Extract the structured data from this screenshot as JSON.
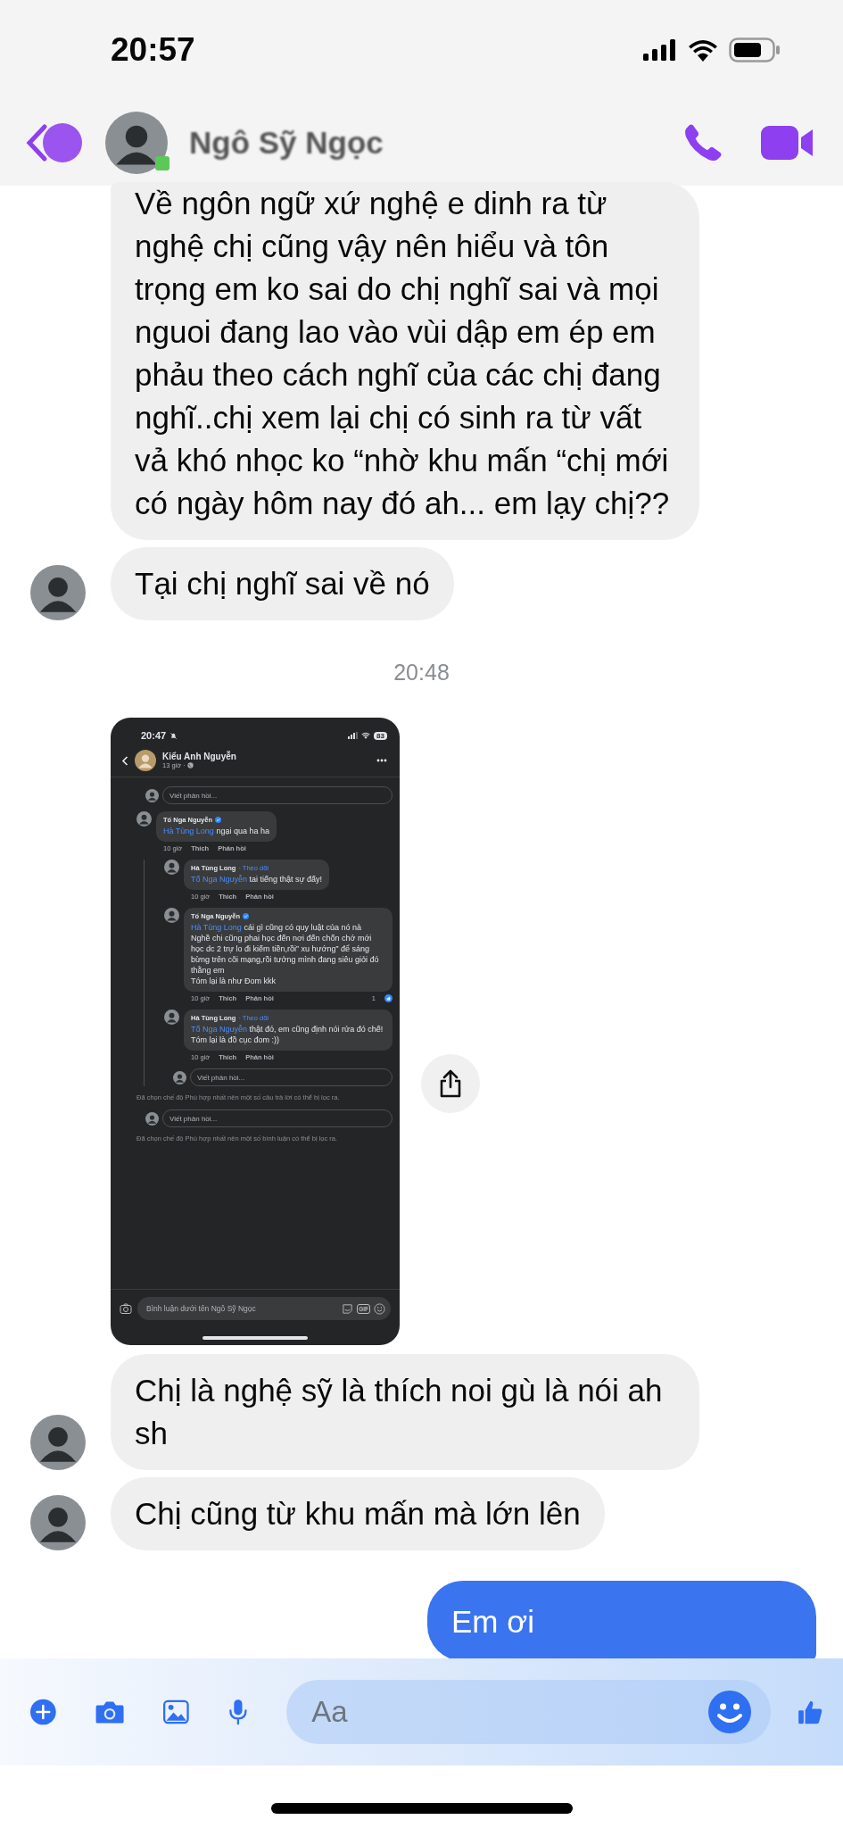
{
  "status_bar": {
    "time": "20:57"
  },
  "header": {
    "name": "Ngô Sỹ Ngọc"
  },
  "messages": [
    {
      "kind": "text",
      "outgoing": false,
      "avatar": false,
      "text": "Về ngôn ngữ xứ nghệ e dinh ra từ nghệ chị cũng vậy nên hiểu và tôn trọng em ko sai do chị nghĩ sai và mọi nguoi đang lao vào vùi dập em ép em phảu theo cách nghĩ của các chị đang nghĩ..chị xem lại chị có sinh ra từ vất vả khó nhọc ko “nhờ khu mấn “chị mới có ngày hôm nay đó ah... em lạy chị??"
    },
    {
      "kind": "text",
      "outgoing": false,
      "avatar": true,
      "text": "Tại chị nghĩ sai về nó"
    },
    {
      "kind": "time",
      "text": "20:48"
    },
    {
      "kind": "screenshot",
      "outgoing": false,
      "avatar": false,
      "shot": {
        "time": "20:47",
        "battery": "83",
        "author": "Kiểu Anh Nguyễn",
        "meta": "13 giờ ·",
        "thread": [
          {
            "kind": "reply_field",
            "placeholder": "Viết phản hồi..."
          },
          {
            "kind": "comment",
            "author": "Tố Nga Nguyễn",
            "verified": true,
            "mention": "Hà Tùng Long",
            "text": "ngại qua ha ha",
            "time": "10 giờ",
            "like": "Thích",
            "reply": "Phản hồi",
            "children": [
              {
                "kind": "comment",
                "author": "Hà Tùng Long",
                "follow": "· Theo dõi",
                "verified": false,
                "mention": "Tố Nga Nguyễn",
                "text": "tai tiếng thật sự đấy!",
                "time": "10 giờ",
                "like": "Thích",
                "reply": "Phản hồi"
              },
              {
                "kind": "comment",
                "author": "Tố Nga Nguyễn",
                "verified": true,
                "mention": "Hà Tùng Long",
                "text": "cái gì cũng có quy luật của nó nà\nNghề chi cũng phai học đến nơi đến chốn chớ mới học dc 2 trự lo đi kiếm tiền,rồi” xu hướng” để sáng bừng trên cõi mạng,rồi tưởng mình đang siêu giỏi đó thằng em\nTóm lại là như Đom kkk",
                "time": "10 giờ",
                "like": "Thích",
                "reply": "Phản hồi",
                "reactions": "1"
              },
              {
                "kind": "comment",
                "author": "Hà Tùng Long",
                "follow": "· Theo dõi",
                "verified": false,
                "mention": "Tố Nga Nguyễn",
                "text": "thật đó, em cũng định nói rửa đó chế! Tóm lại là đồ cục đom :))",
                "time": "10 giờ",
                "like": "Thích",
                "reply": "Phản hồi"
              },
              {
                "kind": "reply_field",
                "placeholder": "Viết phản hồi..."
              }
            ]
          },
          {
            "kind": "note",
            "text": "Đã chọn chế độ Phù hợp nhất nên một số câu trả lời có thể bị lọc ra."
          },
          {
            "kind": "reply_field",
            "placeholder": "Viết phản hồi..."
          },
          {
            "kind": "note",
            "text": "Đã chọn chế độ Phù hợp nhất nên một số bình luận có thể bị lọc ra."
          }
        ],
        "composer": {
          "placeholder": "Bình luận dưới tên Ngô Sỹ Ngọc",
          "gif": "GIF"
        }
      }
    },
    {
      "kind": "text",
      "outgoing": false,
      "avatar": true,
      "text": "Chị là nghệ sỹ là thích noi gù là nói ah sh"
    },
    {
      "kind": "text",
      "outgoing": false,
      "avatar": true,
      "text": "Chị cũng từ khu mấn mà lớn lên"
    },
    {
      "kind": "text",
      "outgoing": true,
      "text": "Em ơi"
    }
  ],
  "composer": {
    "placeholder": "Aa"
  }
}
